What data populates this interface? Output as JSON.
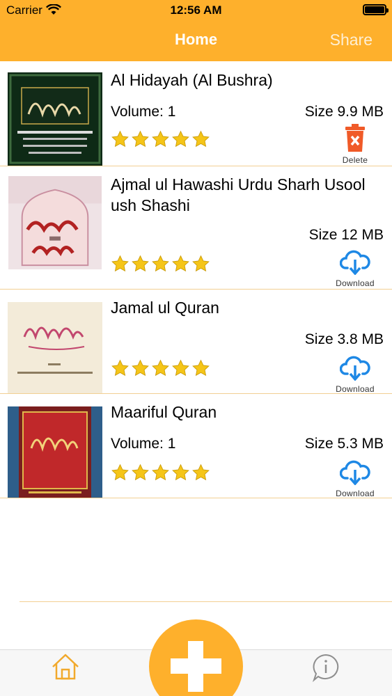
{
  "status_bar": {
    "carrier": "Carrier",
    "time": "12:56 AM"
  },
  "nav": {
    "title": "Home",
    "share_label": "Share"
  },
  "books": [
    {
      "title": "Al Hidayah (Al Bushra)",
      "volume": "Volume: 1",
      "size": "Size 9.9 MB",
      "rating": 5,
      "action": "Delete",
      "action_icon": "trash-icon"
    },
    {
      "title": " Ajmal ul Hawashi Urdu Sharh Usool ush Shashi",
      "volume": "",
      "size": "Size 12 MB",
      "rating": 5,
      "action": "Download",
      "action_icon": "cloud-download-icon"
    },
    {
      "title": "Jamal ul Quran",
      "volume": "",
      "size": "Size 3.8 MB",
      "rating": 5,
      "action": "Download",
      "action_icon": "cloud-download-icon"
    },
    {
      "title": "Maariful Quran",
      "volume": "Volume: 1",
      "size": "Size 5.3 MB",
      "rating": 5,
      "action": "Download",
      "action_icon": "cloud-download-icon"
    }
  ],
  "tabbar": {
    "home_icon": "home-icon",
    "add_icon": "plus-icon",
    "info_icon": "info-icon"
  },
  "colors": {
    "accent": "#FEB02C",
    "star": "#F5C518",
    "download": "#1E88E5",
    "delete": "#F05A28",
    "separator": "#F2CF92"
  }
}
